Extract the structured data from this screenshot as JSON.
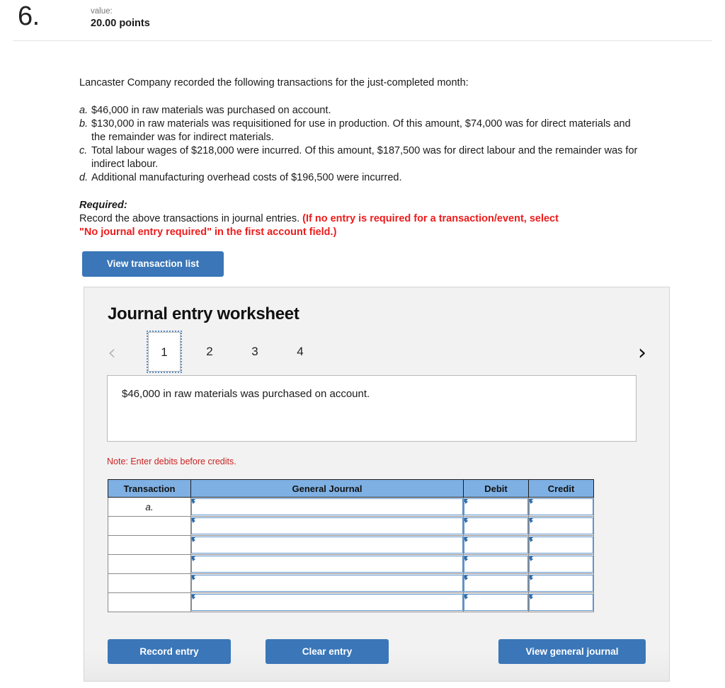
{
  "question": {
    "number": "6.",
    "value_label": "value:",
    "points": "20.00 points"
  },
  "problem": {
    "intro": "Lancaster Company recorded the following transactions for the just-completed month:",
    "transactions": [
      {
        "letter": "a.",
        "text": "$46,000 in raw materials was purchased on account."
      },
      {
        "letter": "b.",
        "text": "$130,000 in raw materials was requisitioned for use in production. Of this amount, $74,000 was for direct materials and the remainder was for indirect materials."
      },
      {
        "letter": "c.",
        "text": "Total labour wages of $218,000 were incurred. Of this amount, $187,500 was for direct labour and the remainder was for indirect labour."
      },
      {
        "letter": "d.",
        "text": "Additional manufacturing overhead costs of $196,500 were incurred."
      }
    ],
    "required_title": "Required:",
    "required_body": "Record the above transactions in journal entries.",
    "required_red_line1": "(If no entry is required for a transaction/event, select",
    "required_red_line2": "\"No journal entry required\" in the first account field.)"
  },
  "buttons": {
    "view_transaction_list": "View transaction list",
    "record_entry": "Record entry",
    "clear_entry": "Clear entry",
    "view_general_journal": "View general journal"
  },
  "worksheet": {
    "title": "Journal entry worksheet",
    "pager": {
      "prev_icon": "chevron-left",
      "prev_glyph": "‹",
      "next_icon": "chevron-right",
      "next_glyph": "›",
      "tabs": [
        "1",
        "2",
        "3",
        "4"
      ],
      "active_tab": "1"
    },
    "scenario_text": "$46,000 in raw materials was purchased on account.",
    "note": "Note: Enter debits before credits.",
    "table": {
      "headers": [
        "Transaction",
        "General Journal",
        "Debit",
        "Credit"
      ],
      "rows": [
        {
          "transaction": "a.",
          "general_journal": "",
          "debit": "",
          "credit": ""
        },
        {
          "transaction": "",
          "general_journal": "",
          "debit": "",
          "credit": ""
        },
        {
          "transaction": "",
          "general_journal": "",
          "debit": "",
          "credit": ""
        },
        {
          "transaction": "",
          "general_journal": "",
          "debit": "",
          "credit": ""
        },
        {
          "transaction": "",
          "general_journal": "",
          "debit": "",
          "credit": ""
        },
        {
          "transaction": "",
          "general_journal": "",
          "debit": "",
          "credit": ""
        }
      ]
    }
  },
  "colors": {
    "button_blue": "#3a76b8",
    "table_header_blue": "#7fb0e3",
    "alert_red": "#ee1b1b",
    "note_red": "#cc2222",
    "panel_gray": "#f2f2f2"
  }
}
